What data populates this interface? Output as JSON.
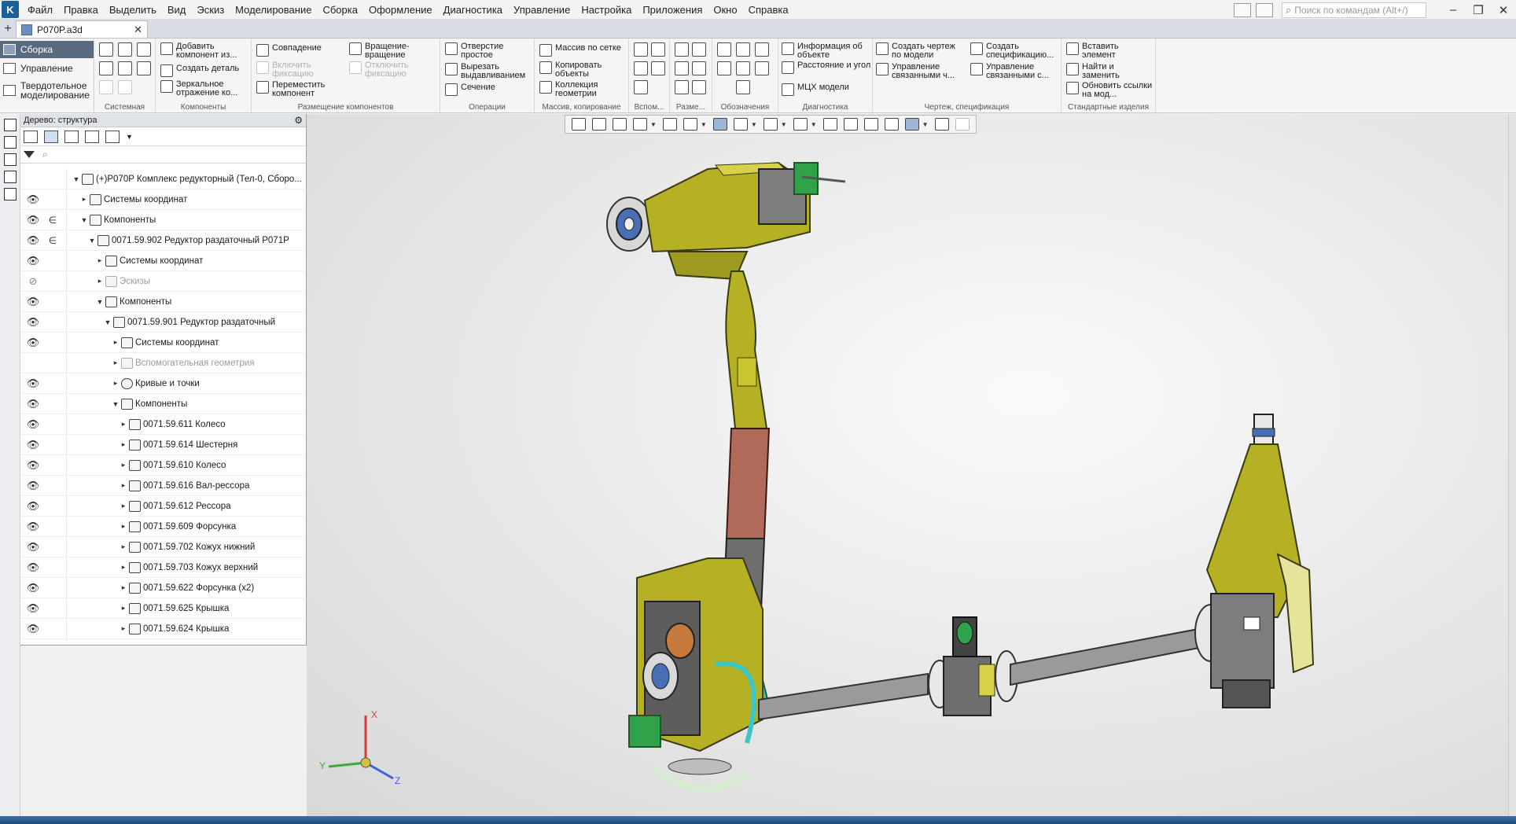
{
  "menu": {
    "items": [
      "Файл",
      "Правка",
      "Выделить",
      "Вид",
      "Эскиз",
      "Моделирование",
      "Сборка",
      "Оформление",
      "Диагностика",
      "Управление",
      "Настройка",
      "Приложения",
      "Окно",
      "Справка"
    ],
    "search_placeholder": "Поиск по командам (Alt+/)"
  },
  "document_tab": {
    "title": "P070P.a3d"
  },
  "ribbon": {
    "modes": {
      "assembly": "Сборка",
      "management": "Управление",
      "solid": "Твердотельное моделирование"
    },
    "groups": {
      "system": "Системная",
      "components": "Компоненты",
      "placement": "Размещение компонентов",
      "operations": "Операции",
      "array": "Массив, копирование",
      "aux": "Вспом...",
      "dims": "Разме...",
      "notation": "Обозначения",
      "diagnostics": "Диагностика",
      "drawing": "Чертеж, спецификация",
      "standard": "Стандартные изделия"
    },
    "buttons": {
      "add_component": "Добавить компонент из...",
      "create_part": "Создать деталь",
      "mirror": "Зеркальное отражение ко...",
      "coincidence": "Совпадение",
      "enable_fix": "Включить фиксацию",
      "move_component": "Переместить компонент",
      "rotation": "Вращение-вращение",
      "disable_fix": "Отключить фиксацию",
      "simple_hole": "Отверстие простое",
      "cut_extrude": "Вырезать выдавливанием",
      "section": "Сечение",
      "grid_array": "Массив по сетке",
      "copy_objects": "Копировать объекты",
      "geometry_collection": "Коллекция геометрии",
      "object_info": "Информация об объекте",
      "distance_angle": "Расстояние и угол",
      "mass_props": "МЦХ модели",
      "create_drawing": "Создать чертеж по модели",
      "create_spec": "Создать спецификацию...",
      "manage_linked_drawings": "Управление связанными ч...",
      "manage_linked_specs": "Управление связанными с...",
      "insert_element": "Вставить элемент",
      "find_replace": "Найти и заменить",
      "update_links": "Обновить ссылки на мод..."
    }
  },
  "tree_panel": {
    "title": "Дерево: структура",
    "filter_value": "",
    "rows": [
      {
        "label": "(+)P070P Комплекс редукторный (Тел-0, Сборо...",
        "visible": true
      },
      {
        "label": "Системы координат",
        "visible": true
      },
      {
        "label": "Компоненты",
        "visible": true
      },
      {
        "label": "0071.59.902 Редуктор раздаточный P071P",
        "visible": true
      },
      {
        "label": "Системы координат",
        "visible": true
      },
      {
        "label": "Эскизы",
        "visible": false
      },
      {
        "label": "Компоненты",
        "visible": true
      },
      {
        "label": "0071.59.901 Редуктор раздаточный",
        "visible": true
      },
      {
        "label": "Системы координат",
        "visible": true
      },
      {
        "label": "Вспомогательная геометрия",
        "visible": false
      },
      {
        "label": "Кривые и точки",
        "visible": true
      },
      {
        "label": "Компоненты",
        "visible": true
      },
      {
        "label": "0071.59.611 Колесо",
        "visible": true
      },
      {
        "label": "0071.59.614 Шестерня",
        "visible": true
      },
      {
        "label": "0071.59.610 Колесо",
        "visible": true
      },
      {
        "label": "0071.59.616 Вал-рессора",
        "visible": true
      },
      {
        "label": "0071.59.612 Рессора",
        "visible": true
      },
      {
        "label": "0071.59.609 Форсунка",
        "visible": true
      },
      {
        "label": "0071.59.702 Кожух нижний",
        "visible": true
      },
      {
        "label": "0071.59.703 Кожух верхний",
        "visible": true
      },
      {
        "label": "0071.59.622 Форсунка (x2)",
        "visible": true
      },
      {
        "label": "0071.59.625 Крышка",
        "visible": true
      },
      {
        "label": "0071.59.624 Крышка",
        "visible": true
      }
    ]
  },
  "axis_triad": {
    "x": "X",
    "y": "Y",
    "z": "Z"
  },
  "colors": {
    "accent": "#5a6a7e",
    "model_yellow": "#b5b024",
    "model_grey": "#6e6e6e",
    "model_cyan": "#3dc6c3",
    "model_red": "#b06a5a"
  }
}
